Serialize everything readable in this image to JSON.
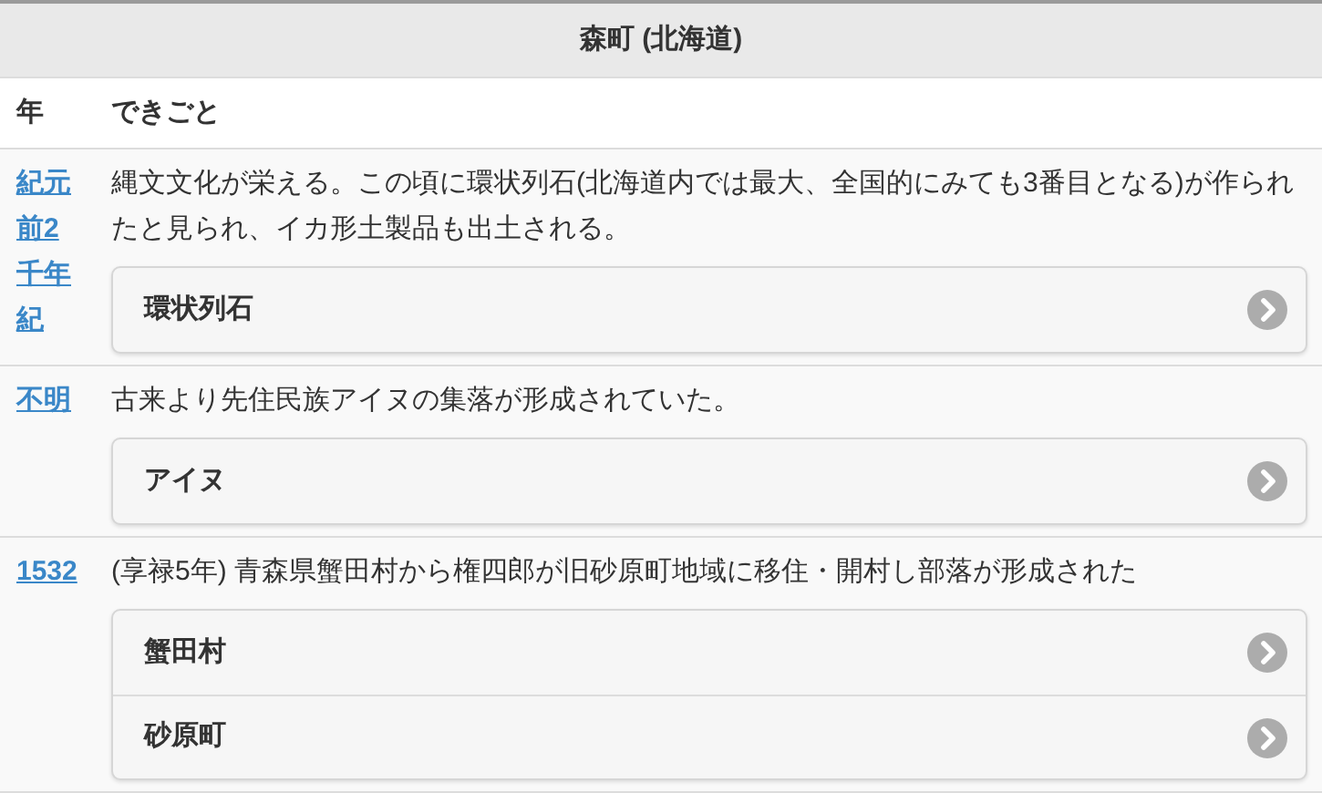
{
  "title": "森町 (北海道)",
  "columns": [
    "年",
    "できごと"
  ],
  "rows": [
    {
      "year": "紀元前2千年紀",
      "text": "縄文文化が栄える。この頃に環状列石(北海道内では最大、全国的にみても3番目となる)が作られたと見られ、イカ形土製品も出土される。",
      "links": [
        "環状列石"
      ]
    },
    {
      "year": "不明",
      "text": "古来より先住民族アイヌの集落が形成されていた。",
      "links": [
        "アイヌ"
      ]
    },
    {
      "year": "1532",
      "text": "(享禄5年) 青森県蟹田村から権四郎が旧砂原町地域に移住・開村し部落が形成された",
      "links": [
        "蟹田村",
        "砂原町"
      ]
    }
  ]
}
